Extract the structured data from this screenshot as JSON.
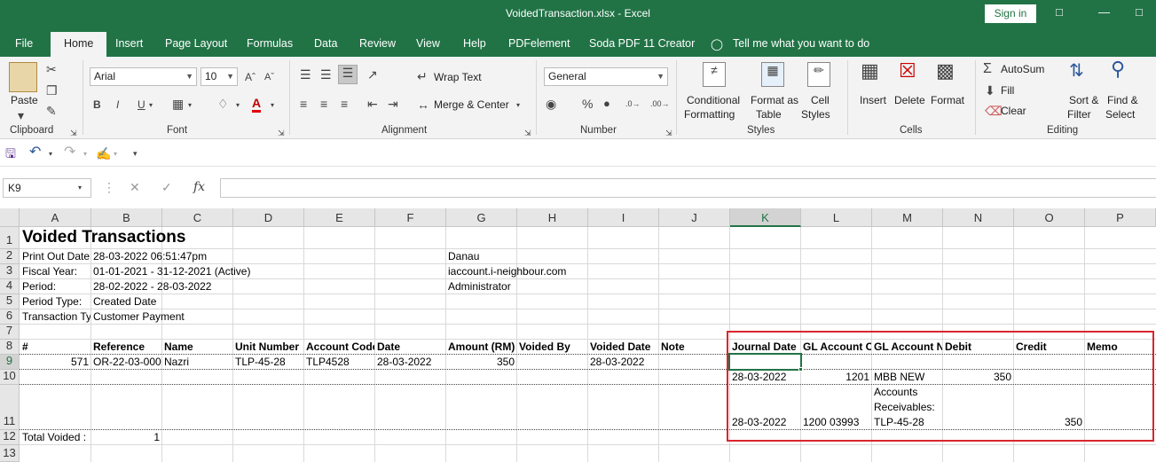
{
  "window": {
    "title": "VoidedTransaction.xlsx - Excel",
    "signin": "Sign in"
  },
  "tabs": [
    "File",
    "Home",
    "Insert",
    "Page Layout",
    "Formulas",
    "Data",
    "Review",
    "View",
    "Help",
    "PDFelement",
    "Soda PDF 11 Creator"
  ],
  "tell_me": "Tell me what you want to do",
  "ribbon": {
    "clipboard": {
      "paste": "Paste",
      "label": "Clipboard"
    },
    "font": {
      "name": "Arial",
      "size": "10",
      "label": "Font",
      "bold": "B",
      "italic": "I",
      "underline": "U"
    },
    "alignment": {
      "wrap": "Wrap Text",
      "merge": "Merge & Center",
      "label": "Alignment"
    },
    "number": {
      "format": "General",
      "label": "Number",
      "percent": "%"
    },
    "styles": {
      "cond1": "Conditional",
      "cond2": "Formatting",
      "fmt1": "Format as",
      "fmt2": "Table",
      "cs1": "Cell",
      "cs2": "Styles",
      "label": "Styles"
    },
    "cells": {
      "insert": "Insert",
      "delete": "Delete",
      "format": "Format",
      "label": "Cells"
    },
    "editing": {
      "autosum": "AutoSum",
      "fill": "Fill",
      "clear": "Clear",
      "sort1": "Sort &",
      "sort2": "Filter",
      "find1": "Find &",
      "find2": "Select",
      "label": "Editing"
    }
  },
  "formula_bar": {
    "name_box": "K9",
    "formula": ""
  },
  "columns": [
    "A",
    "B",
    "C",
    "D",
    "E",
    "F",
    "G",
    "H",
    "I",
    "J",
    "K",
    "L",
    "M",
    "N",
    "O",
    "P"
  ],
  "rows": [
    "1",
    "2",
    "3",
    "4",
    "5",
    "6",
    "7",
    "8",
    "9",
    "10",
    "11",
    "12",
    "13"
  ],
  "sheet": {
    "title": "Voided Transactions",
    "print_label": "Print Out Date",
    "print_value": "28-03-2022 06:51:47pm",
    "fiscal_label": "Fiscal Year:",
    "fiscal_value": "01-01-2021 - 31-12-2021  (Active)",
    "period_label": "Period:",
    "period_value": "28-02-2022 - 28-03-2022",
    "ptype_label": "Period Type:",
    "ptype_value": "Created Date",
    "ttype_label": "Transaction Ty",
    "ttype_value": "Customer Payment",
    "company": "Danau",
    "site": "iaccount.i-neighbour.com",
    "user": "Administrator",
    "headers": [
      "#",
      "Reference",
      "Name",
      "Unit Number",
      "Account Code",
      "Date",
      "Amount (RM)",
      "Voided By",
      "Voided Date",
      "Note",
      "Journal Date",
      "GL Account Co",
      "GL Account Na",
      "Debit",
      "Credit",
      "Memo"
    ],
    "row9": {
      "num": "571",
      "ref": "OR-22-03-000",
      "name": "Nazri",
      "unit": "TLP-45-28",
      "acct": "TLP4528",
      "date": "28-03-2022",
      "amount": "350",
      "voided_date": "28-03-2022"
    },
    "row10": {
      "jdate": "28-03-2022",
      "gl_code": "1201",
      "gl_name": "MBB NEW",
      "debit": "350"
    },
    "row11": {
      "jdate": "28-03-2022",
      "gl_code": "1200 03993",
      "gl_name1": "Accounts",
      "gl_name2": "Receivables:",
      "gl_name3": "TLP-45-28",
      "credit": "350"
    },
    "total_label": "Total Voided :",
    "total_value": "1"
  }
}
